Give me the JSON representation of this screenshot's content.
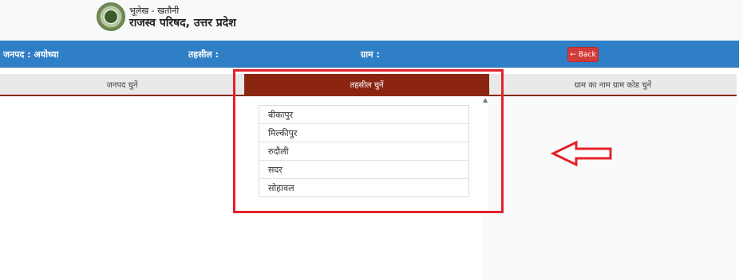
{
  "header": {
    "subtitle": "भूलेख - खतौनी",
    "title": "राजस्व परिषद, उत्तर प्रदेश"
  },
  "info": {
    "district_label": "जनपद : अयोध्या",
    "tehsil_label": "तहसील :",
    "village_label": "ग्राम :",
    "back_label": "Back"
  },
  "tabs": [
    {
      "label": "जनपद चुनें",
      "active": false
    },
    {
      "label": "तहसील चुनें",
      "active": true
    },
    {
      "label": "ग्राम का नाम ग्राम कोड चुनें",
      "active": false
    }
  ],
  "tehsils": [
    "बीकापुर",
    "मिल्कीपुर",
    "रुदौली",
    "सदर",
    "सोहावल"
  ],
  "colors": {
    "infobar": "#2f7fc6",
    "active_tab": "#8b2512",
    "back_button": "#d33b3b",
    "annotation": "#e3222c"
  }
}
